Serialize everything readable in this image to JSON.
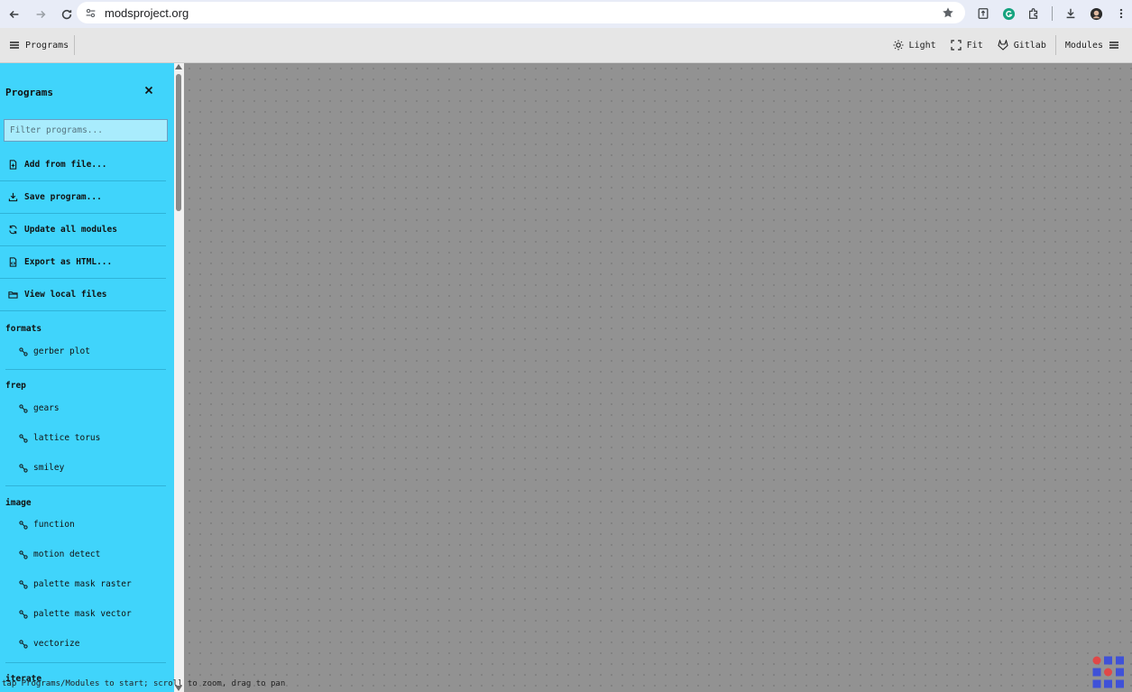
{
  "browser": {
    "url": "modsproject.org"
  },
  "toolbar": {
    "programs_label": "Programs",
    "light_label": "Light",
    "fit_label": "Fit",
    "gitlab_label": "Gitlab",
    "modules_label": "Modules"
  },
  "sidebar": {
    "title": "Programs",
    "filter_placeholder": "Filter programs...",
    "actions": [
      {
        "label": "Add from file...",
        "icon": "file-add-icon"
      },
      {
        "label": "Save program...",
        "icon": "download-icon"
      },
      {
        "label": "Update all modules",
        "icon": "refresh-icon"
      },
      {
        "label": "Export as HTML...",
        "icon": "file-code-icon"
      },
      {
        "label": "View local files",
        "icon": "folder-icon"
      }
    ],
    "categories": [
      {
        "name": "formats",
        "programs": [
          "gerber plot"
        ]
      },
      {
        "name": "frep",
        "programs": [
          "gears",
          "lattice torus",
          "smiley"
        ]
      },
      {
        "name": "image",
        "programs": [
          "function",
          "motion detect",
          "palette mask raster",
          "palette mask vector",
          "vectorize"
        ]
      },
      {
        "name": "iterate",
        "programs": []
      }
    ]
  },
  "status_text": "tap Programs/Modules to start; scroll to zoom, drag to pan",
  "colors": {
    "sidebar_bg": "#40d4fb",
    "canvas_bg": "#929292",
    "logo_blue": "#3f51d8",
    "logo_red": "#e04848"
  }
}
